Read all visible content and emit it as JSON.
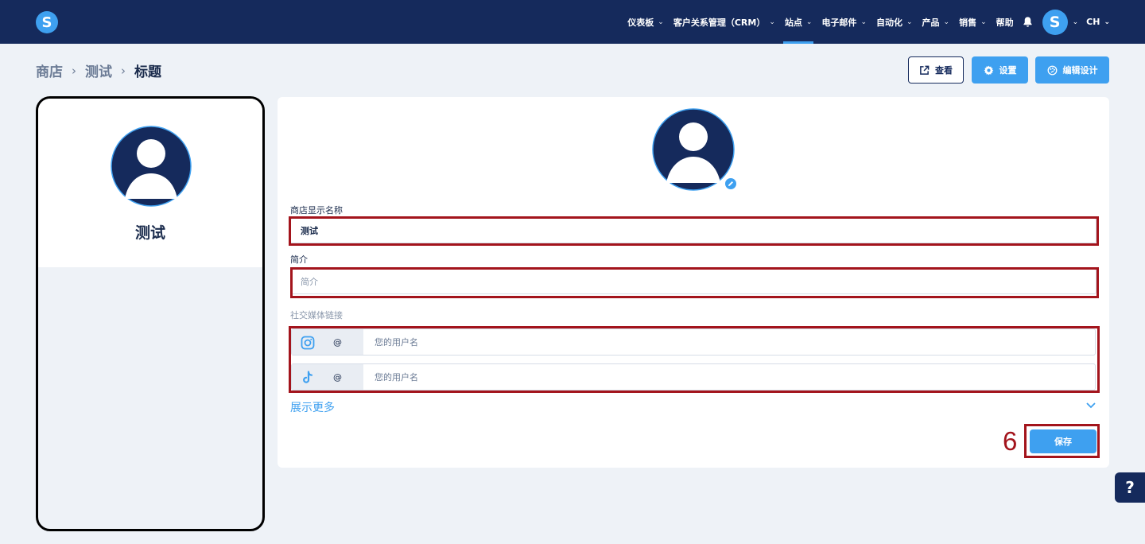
{
  "nav": {
    "logo": "S",
    "items": [
      {
        "label": "仪表板",
        "chevron": "⌄"
      },
      {
        "label": "客户关系管理（CRM）",
        "chevron": "⌄"
      },
      {
        "label": "站点",
        "chevron": "⌄"
      },
      {
        "label": "电子邮件",
        "chevron": "⌄"
      },
      {
        "label": "自动化",
        "chevron": "⌄"
      },
      {
        "label": "产品",
        "chevron": "⌄"
      },
      {
        "label": "销售",
        "chevron": "⌄"
      },
      {
        "label": "帮助",
        "chevron": ""
      }
    ],
    "active_item": "站点",
    "user_initial": "S",
    "language": "CH",
    "icons": {
      "notifications": "bell-icon"
    }
  },
  "breadcrumb": {
    "items": [
      "商店",
      "测试",
      "标题"
    ],
    "separator": "›"
  },
  "header_buttons": {
    "view": "查看",
    "settings": "设置",
    "edit_design": "编辑设计"
  },
  "preview": {
    "store_name": "测试"
  },
  "form": {
    "display_name_label": "商店显示名称",
    "display_name_value": "测试",
    "bio_label": "简介",
    "bio_placeholder": "简介",
    "social_label": "社交媒体链接",
    "social_links": [
      {
        "icon": "instagram-icon",
        "prefix": "@",
        "placeholder": "您的用户名"
      },
      {
        "icon": "tiktok-icon",
        "prefix": "@",
        "placeholder": "您的用户名"
      }
    ],
    "show_more": "展示更多",
    "save": "保存"
  },
  "annotation": {
    "step_number": "6",
    "color": "#a3141c"
  },
  "help": "?",
  "colors": {
    "nav_bg": "#152a5c",
    "accent": "#3ea0f0",
    "page_bg": "#eef2f7"
  }
}
